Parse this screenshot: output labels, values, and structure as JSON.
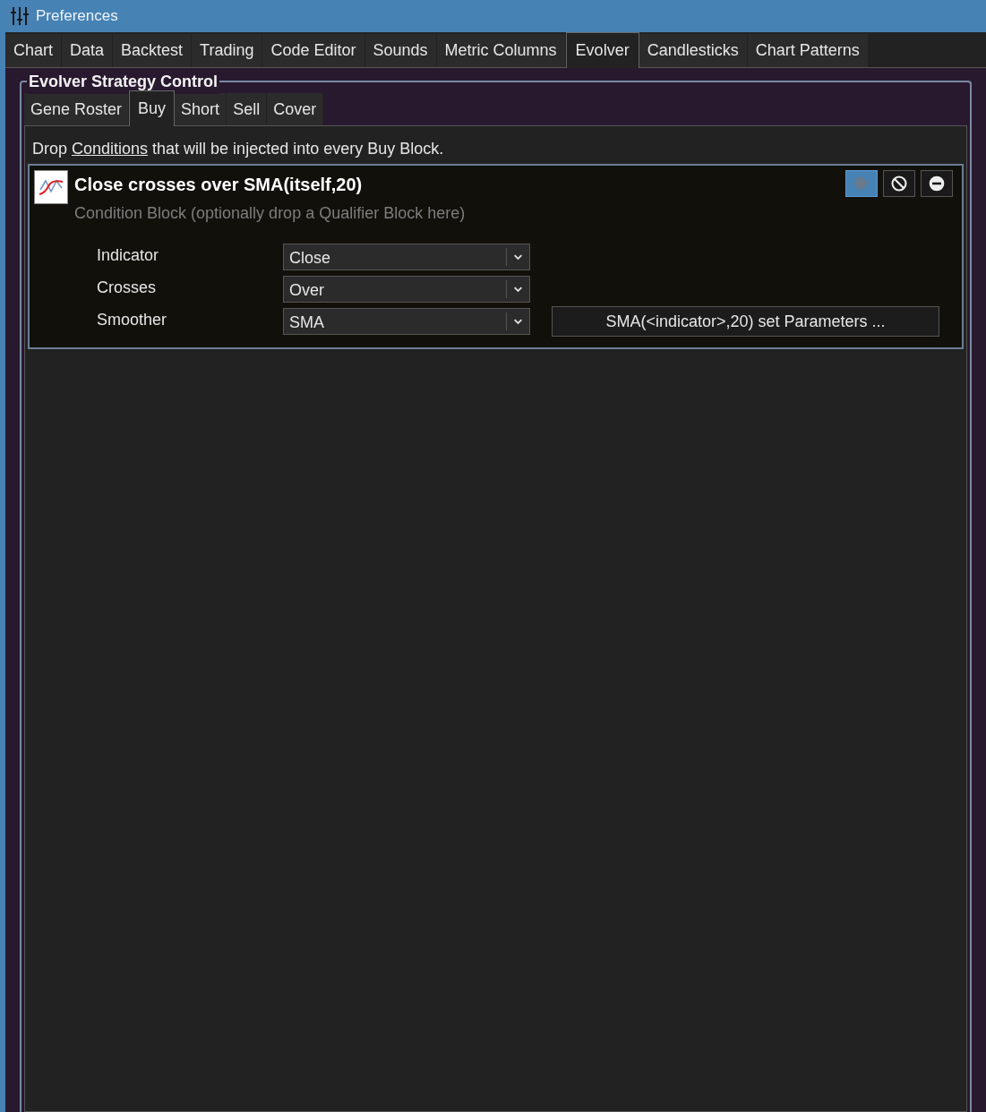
{
  "window": {
    "title": "Preferences"
  },
  "tabs": [
    {
      "label": "Chart",
      "selected": false
    },
    {
      "label": "Data",
      "selected": false
    },
    {
      "label": "Backtest",
      "selected": false
    },
    {
      "label": "Trading",
      "selected": false
    },
    {
      "label": "Code Editor",
      "selected": false
    },
    {
      "label": "Sounds",
      "selected": false
    },
    {
      "label": "Metric Columns",
      "selected": false
    },
    {
      "label": "Evolver",
      "selected": true
    },
    {
      "label": "Candlesticks",
      "selected": false
    },
    {
      "label": "Chart Patterns",
      "selected": false
    }
  ],
  "group": {
    "title": "Evolver Strategy Control",
    "tabs": [
      {
        "label": "Gene Roster",
        "selected": false
      },
      {
        "label": "Buy",
        "selected": true
      },
      {
        "label": "Short",
        "selected": false
      },
      {
        "label": "Sell",
        "selected": false
      },
      {
        "label": "Cover",
        "selected": false
      }
    ],
    "instruction": {
      "before": "Drop ",
      "link": "Conditions",
      "after": " that will be injected into every Buy Block."
    },
    "block": {
      "title": "Close crosses over SMA(itself,20)",
      "subtitle": "Condition Block (optionally drop a Qualifier Block here)",
      "actions": [
        {
          "kind": "settings",
          "selected": true
        },
        {
          "kind": "disable",
          "selected": false
        },
        {
          "kind": "remove",
          "selected": false
        }
      ],
      "fields": [
        {
          "label": "Indicator",
          "value": "Close"
        },
        {
          "label": "Crosses",
          "value": "Over"
        },
        {
          "label": "Smoother",
          "value": "SMA",
          "button": "SMA(<indicator>,20) set Parameters ..."
        }
      ]
    }
  }
}
